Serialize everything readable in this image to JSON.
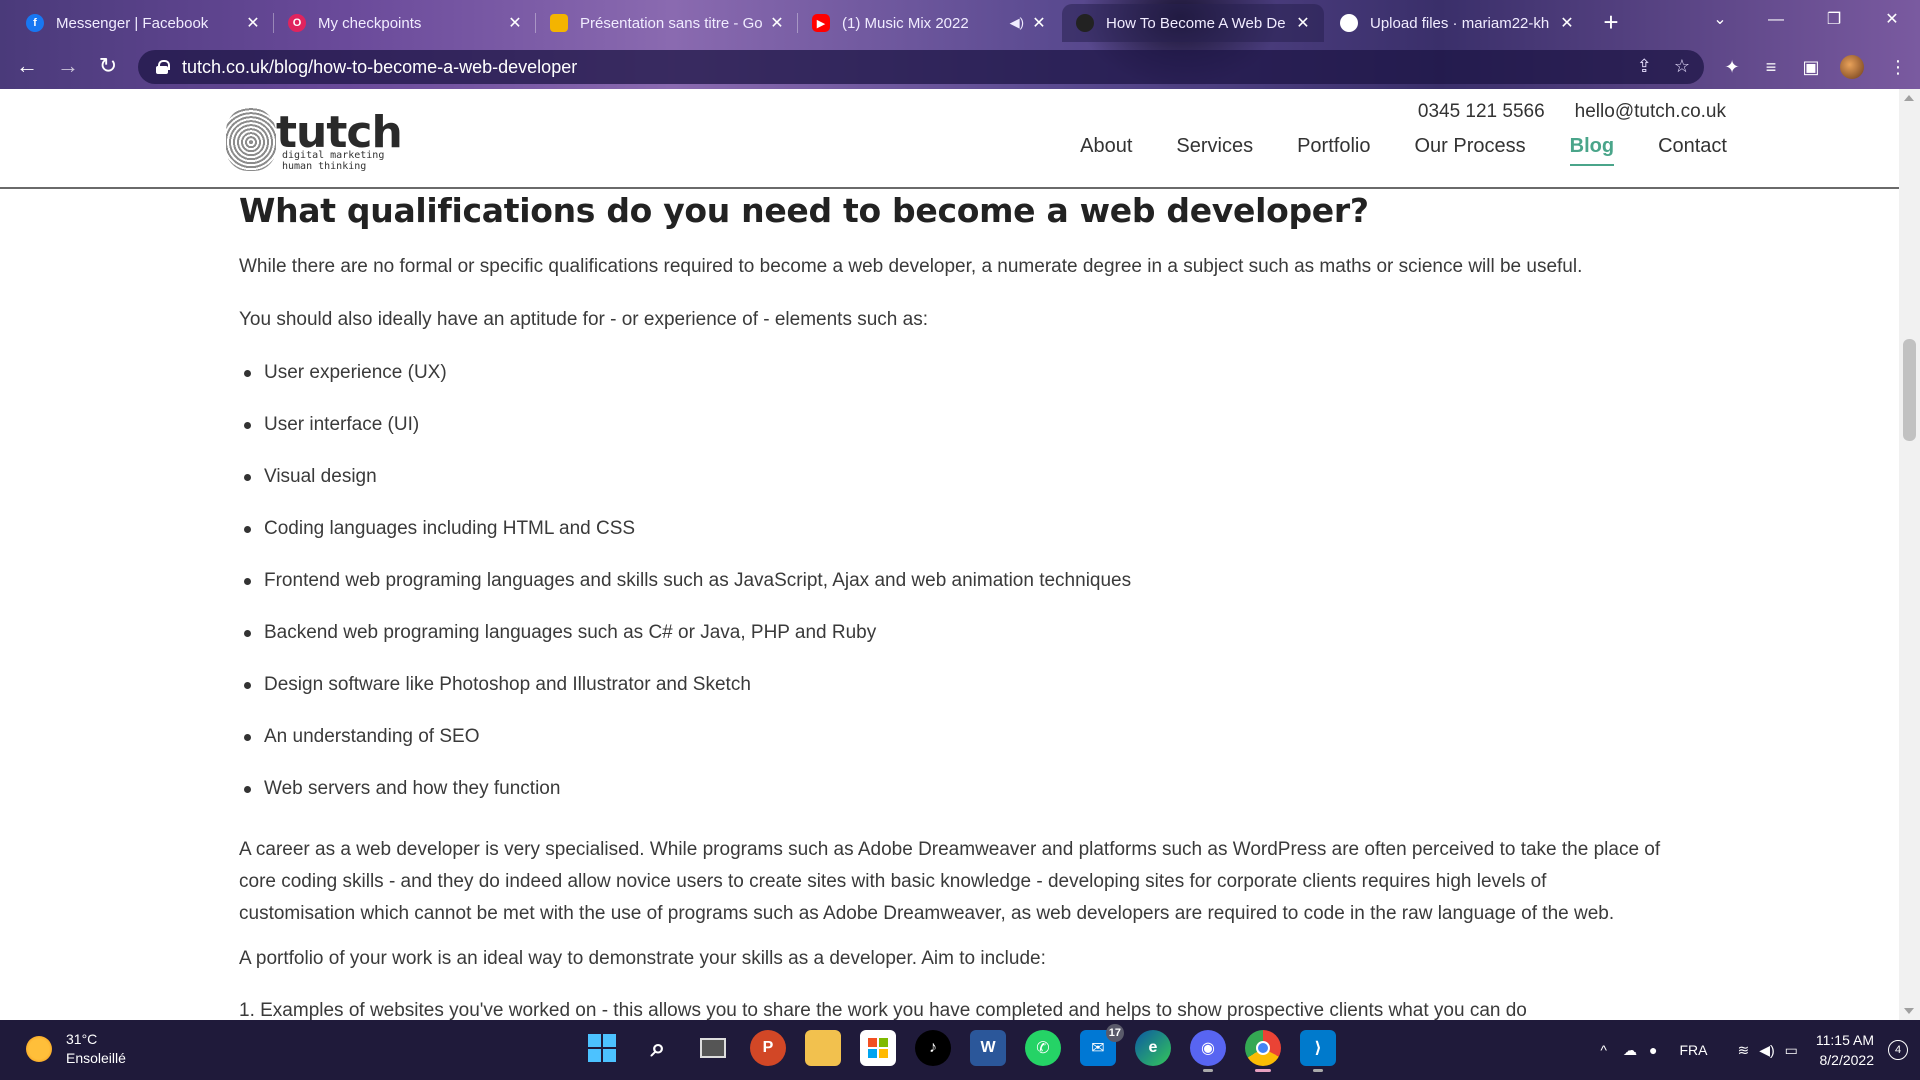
{
  "browser": {
    "tabs": [
      {
        "title": "Messenger | Facebook",
        "favicon": "facebook-icon",
        "color": "#1877f2"
      },
      {
        "title": "My checkpoints",
        "favicon": "opera-icon",
        "color": "#e0245e"
      },
      {
        "title": "Présentation sans titre - Go",
        "favicon": "slides-icon",
        "color": "#f4b400"
      },
      {
        "title": "(1) Music Mix 2022",
        "favicon": "youtube-icon",
        "color": "#ff0000"
      },
      {
        "title": "How To Become A Web De",
        "favicon": "tutch-icon",
        "color": "#222222",
        "active": true
      },
      {
        "title": "Upload files · mariam22-kh",
        "favicon": "github-icon",
        "color": "#ffffff"
      }
    ],
    "url": "tutch.co.uk/blog/how-to-become-a-web-developer"
  },
  "site": {
    "logo_word": "tutch",
    "logo_tagline_1": "digital marketing",
    "logo_tagline_2": "human thinking",
    "phone": "0345 121 5566",
    "email": "hello@tutch.co.uk",
    "nav": [
      {
        "label": "About"
      },
      {
        "label": "Services"
      },
      {
        "label": "Portfolio"
      },
      {
        "label": "Our Process"
      },
      {
        "label": "Blog",
        "active": true
      },
      {
        "label": "Contact"
      }
    ],
    "accent_color": "#4aa58a"
  },
  "article": {
    "heading": "What qualifications do you need to become a web developer?",
    "intro": "While there are no formal or specific qualifications required to become a web developer, a numerate degree in a subject such as maths or science will be useful.",
    "aptitude": "You should also ideally have an aptitude for - or experience of - elements such as:",
    "bullets": [
      "User experience (UX)",
      "User interface (UI)",
      "Visual design",
      "Coding languages including HTML and CSS",
      "Frontend web programing languages and skills such as JavaScript, Ajax and web animation techniques",
      "Backend web programing languages such as C# or Java, PHP and Ruby",
      "Design software like Photoshop and Illustrator and Sketch",
      "An understanding of SEO",
      "Web servers and how they function"
    ],
    "career": "A career as a web developer is very specialised. While programs such as Adobe Dreamweaver and platforms such as WordPress are often perceived to take the place of core coding skills - and they do indeed allow novice users to create sites with basic knowledge - developing sites for corporate clients requires high levels of customisation which cannot be met with the use of programs such as Adobe Dreamweaver, as web developers are required to code in the raw language of the web.",
    "portfolio": "A portfolio of your work is an ideal way to demonstrate your skills as a developer. Aim to include:",
    "numbered_first": "1. Examples of websites you've worked on - this allows you to share the work you have completed and helps to show prospective clients what you can do"
  },
  "taskbar": {
    "temp": "31°C",
    "weather": "Ensoleillé",
    "language": "FRA",
    "time": "11:15 AM",
    "date": "8/2/2022",
    "notifications": "4",
    "mail_badge": "17"
  }
}
